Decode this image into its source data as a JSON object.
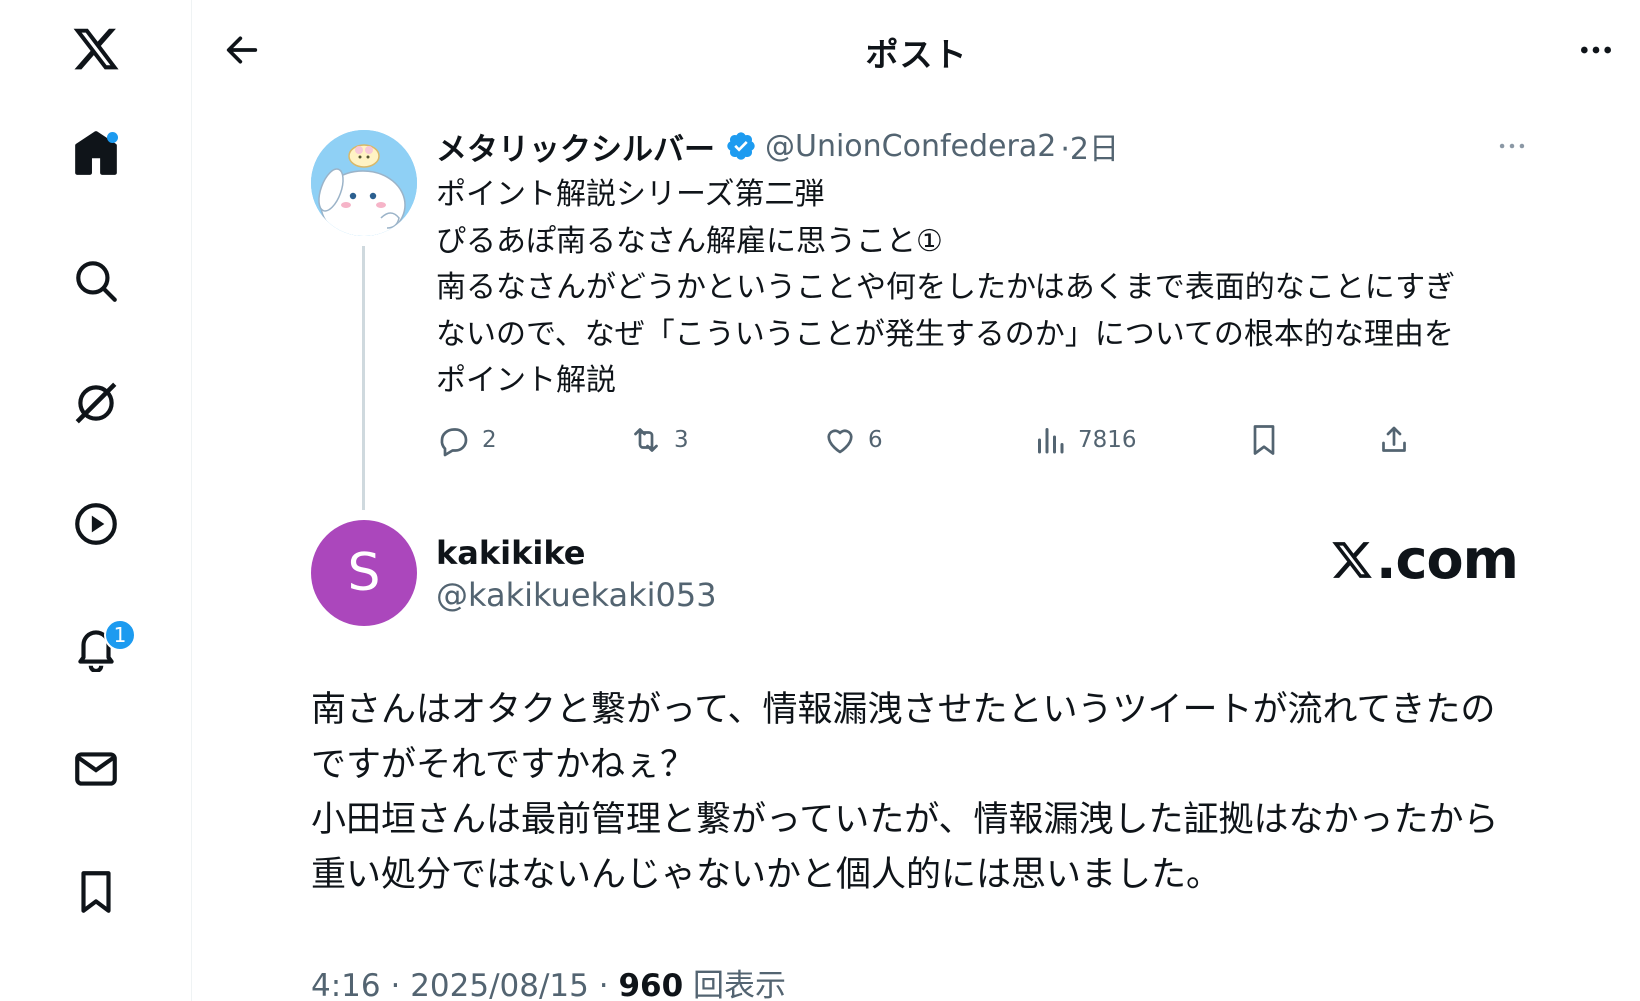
{
  "header": {
    "title": "ポスト"
  },
  "sidebar": {
    "items": [
      {
        "icon": "x-logo-icon"
      },
      {
        "icon": "home-icon",
        "has_dot": true
      },
      {
        "icon": "search-icon"
      },
      {
        "icon": "grok-icon"
      },
      {
        "icon": "video-icon"
      },
      {
        "icon": "bell-icon",
        "badge": "1"
      },
      {
        "icon": "mail-icon"
      },
      {
        "icon": "bookmark-icon"
      }
    ]
  },
  "quoted": {
    "name": "メタリックシルバー",
    "handle": "@UnionConfedera2",
    "time": "·2日",
    "text": "ポイント解説シリーズ第二弾\nぴるあぽ南るなさん解雇に思うこと①\n南るなさんがどうかということや何をしたかはあくまで表面的なことにすぎ\nないので、なぜ「こういうことが発生するのか」についての根本的な理由を\nポイント解説",
    "stats": {
      "replies": "2",
      "reposts": "3",
      "likes": "6",
      "views": "7816"
    }
  },
  "tweet": {
    "avatar_letter": "S",
    "name": "kakikike",
    "handle": "@kakikuekaki053",
    "watermark": ".com",
    "text": "南さんはオタクと繋がって、情報漏洩させたというツイートが流れてきたの\nですがそれですかねぇ？\n小田垣さんは最前管理と繋がっていたが、情報漏洩した証拠はなかったから\n重い処分ではないんじゃないかと個人的には思いました。",
    "time": "4:16",
    "date": "2025/08/15",
    "views": "960",
    "views_label": "回表示"
  },
  "colors": {
    "accent": "#1d9bf0",
    "text": "#0f1419",
    "muted": "#536471",
    "avatar": "#ab47bc"
  }
}
